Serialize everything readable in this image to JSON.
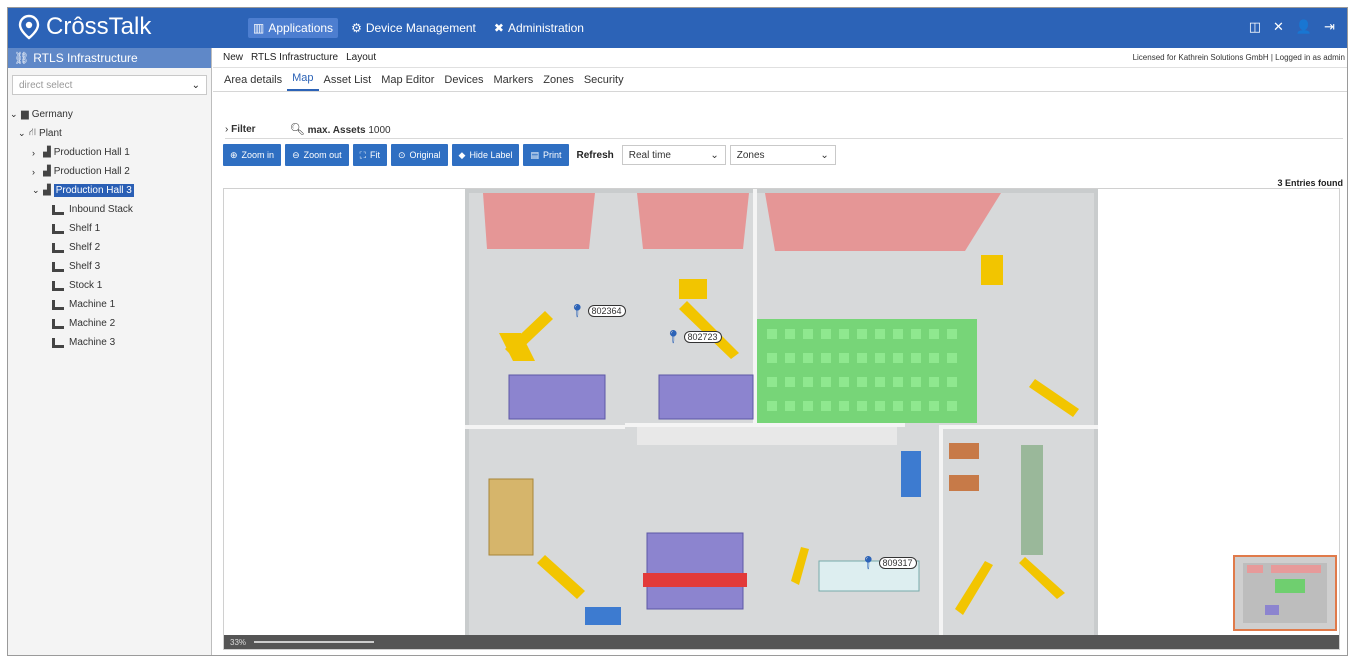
{
  "app": {
    "logo_text": "CrôssTalk"
  },
  "topnav": {
    "items": [
      {
        "label": "Applications",
        "icon": "chart-icon",
        "active": true
      },
      {
        "label": "Device Management",
        "icon": "gears-icon",
        "active": false
      },
      {
        "label": "Administration",
        "icon": "tools-icon",
        "active": false
      }
    ],
    "right_icons": [
      "layout-icon",
      "fullscreen-icon",
      "user-icon",
      "logout-icon"
    ]
  },
  "sidebar": {
    "title": "RTLS Infrastructure",
    "select_placeholder": "direct select",
    "tree": [
      {
        "label": "Germany",
        "level": 0,
        "icon": "folder-icon",
        "expanded": true
      },
      {
        "label": "Plant",
        "level": 1,
        "icon": "sitemap-icon",
        "expanded": true
      },
      {
        "label": "Production Hall 1",
        "level": 2,
        "icon": "hall-icon",
        "expanded": false
      },
      {
        "label": "Production Hall 2",
        "level": 2,
        "icon": "hall-icon",
        "expanded": false
      },
      {
        "label": "Production Hall 3",
        "level": 2,
        "icon": "hall-icon",
        "expanded": true,
        "selected": true
      },
      {
        "label": "Inbound Stack",
        "level": 3,
        "icon": "shelf-icon"
      },
      {
        "label": "Shelf 1",
        "level": 3,
        "icon": "shelf-icon"
      },
      {
        "label": "Shelf 2",
        "level": 3,
        "icon": "shelf-icon"
      },
      {
        "label": "Shelf 3",
        "level": 3,
        "icon": "shelf-icon"
      },
      {
        "label": "Stock 1",
        "level": 3,
        "icon": "shelf-icon"
      },
      {
        "label": "Machine 1",
        "level": 3,
        "icon": "shelf-icon"
      },
      {
        "label": "Machine 2",
        "level": 3,
        "icon": "shelf-icon"
      },
      {
        "label": "Machine 3",
        "level": 3,
        "icon": "shelf-icon"
      }
    ]
  },
  "breadcrumb": {
    "items": [
      "New",
      "RTLS Infrastructure",
      "Layout"
    ],
    "license": "Licensed for Kathrein Solutions GmbH | Logged in as admin"
  },
  "tabs": [
    {
      "label": "Area details",
      "active": false
    },
    {
      "label": "Map",
      "active": true
    },
    {
      "label": "Asset List",
      "active": false
    },
    {
      "label": "Map Editor",
      "active": false
    },
    {
      "label": "Devices",
      "active": false
    },
    {
      "label": "Markers",
      "active": false
    },
    {
      "label": "Zones",
      "active": false
    },
    {
      "label": "Security",
      "active": false
    }
  ],
  "filter": {
    "label": "Filter",
    "max_assets_label": "max. Assets",
    "max_assets_value": "1000"
  },
  "toolbar": {
    "zoom_in": "Zoom in",
    "zoom_out": "Zoom out",
    "fit": "Fit",
    "original": "Original",
    "hide_label": "Hide Label",
    "print": "Print",
    "refresh_label": "Refresh",
    "refresh_value": "Real time",
    "zones_value": "Zones"
  },
  "entries_found": "3 Entries found",
  "map": {
    "markers": [
      {
        "id": "802364"
      },
      {
        "id": "802723"
      },
      {
        "id": "809317"
      }
    ],
    "zoom_text": "33%"
  },
  "colors": {
    "header": "#2c63b7",
    "button": "#2f6fc2",
    "zone_red": "#e88a8a",
    "zone_green": "#5fd35f",
    "forklift": "#f2c500"
  }
}
